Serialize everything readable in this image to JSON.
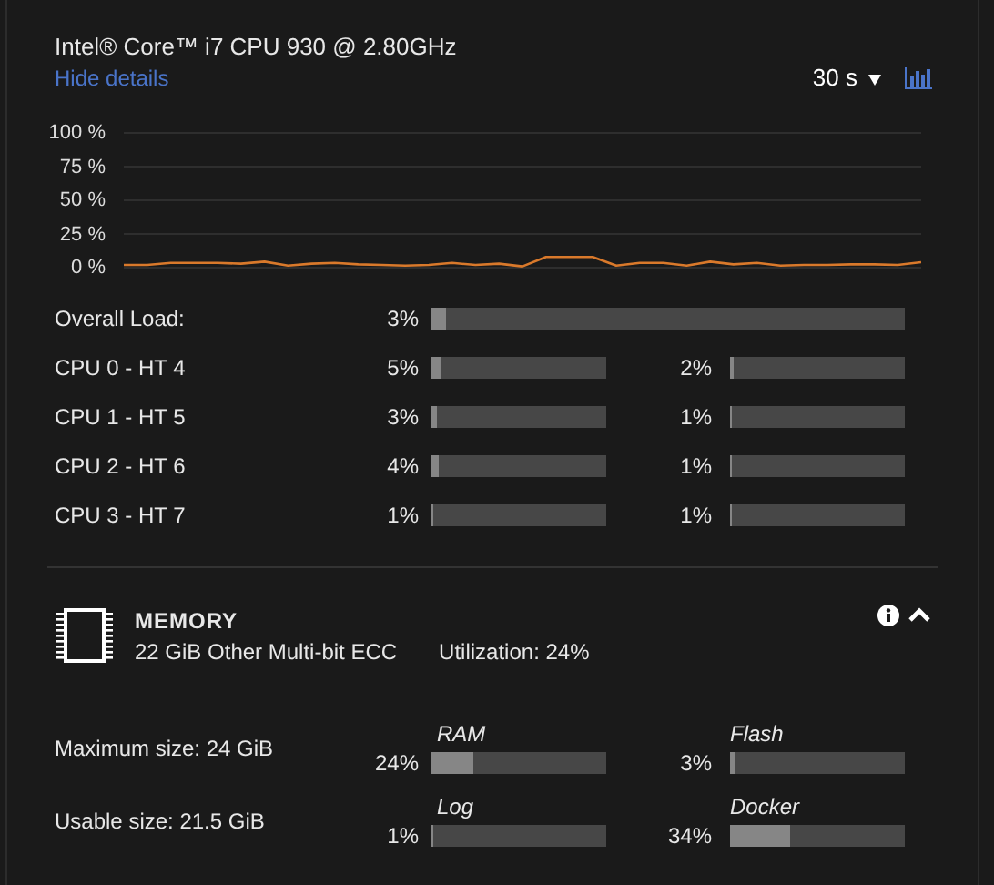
{
  "processor": {
    "title": "Intel® Core™ i7 CPU 930 @ 2.80GHz",
    "hide_details_link": "Hide details",
    "interval": "30 s",
    "chart": {
      "y_axis_labels": [
        "100 %",
        "75 %",
        "50 %",
        "25 %",
        "0 %"
      ]
    },
    "load": [
      {
        "label": "Overall Load:",
        "cells": [
          {
            "reading": "3%",
            "level": 0.03
          }
        ]
      },
      {
        "label": "CPU 0 - HT 4",
        "cells": [
          {
            "reading": "5%",
            "level": 0.05
          },
          {
            "reading": "2%",
            "level": 0.02
          }
        ]
      },
      {
        "label": "CPU 1 - HT 5",
        "cells": [
          {
            "reading": "3%",
            "level": 0.03
          },
          {
            "reading": "1%",
            "level": 0.01
          }
        ]
      },
      {
        "label": "CPU 2 - HT 6",
        "cells": [
          {
            "reading": "4%",
            "level": 0.04
          },
          {
            "reading": "1%",
            "level": 0.01
          }
        ]
      },
      {
        "label": "CPU 3 - HT 7",
        "cells": [
          {
            "reading": "1%",
            "level": 0.01
          },
          {
            "reading": "1%",
            "level": 0.01
          }
        ]
      }
    ]
  },
  "memory": {
    "title": "MEMORY",
    "description": "22 GiB Other Multi-bit ECC",
    "utilization": "Utilization: 24%",
    "expanded": true,
    "sizes": [
      {
        "label": "Maximum size: 24 GiB",
        "meters": [
          {
            "name": "RAM",
            "reading": "24%",
            "level": 0.24
          },
          {
            "name": "Flash",
            "reading": "3%",
            "level": 0.03
          }
        ]
      },
      {
        "label": "Usable size: 21.5 GiB",
        "meters": [
          {
            "name": "Log",
            "reading": "1%",
            "level": 0.01
          },
          {
            "name": "Docker",
            "reading": "34%",
            "level": 0.34
          }
        ]
      }
    ]
  }
}
